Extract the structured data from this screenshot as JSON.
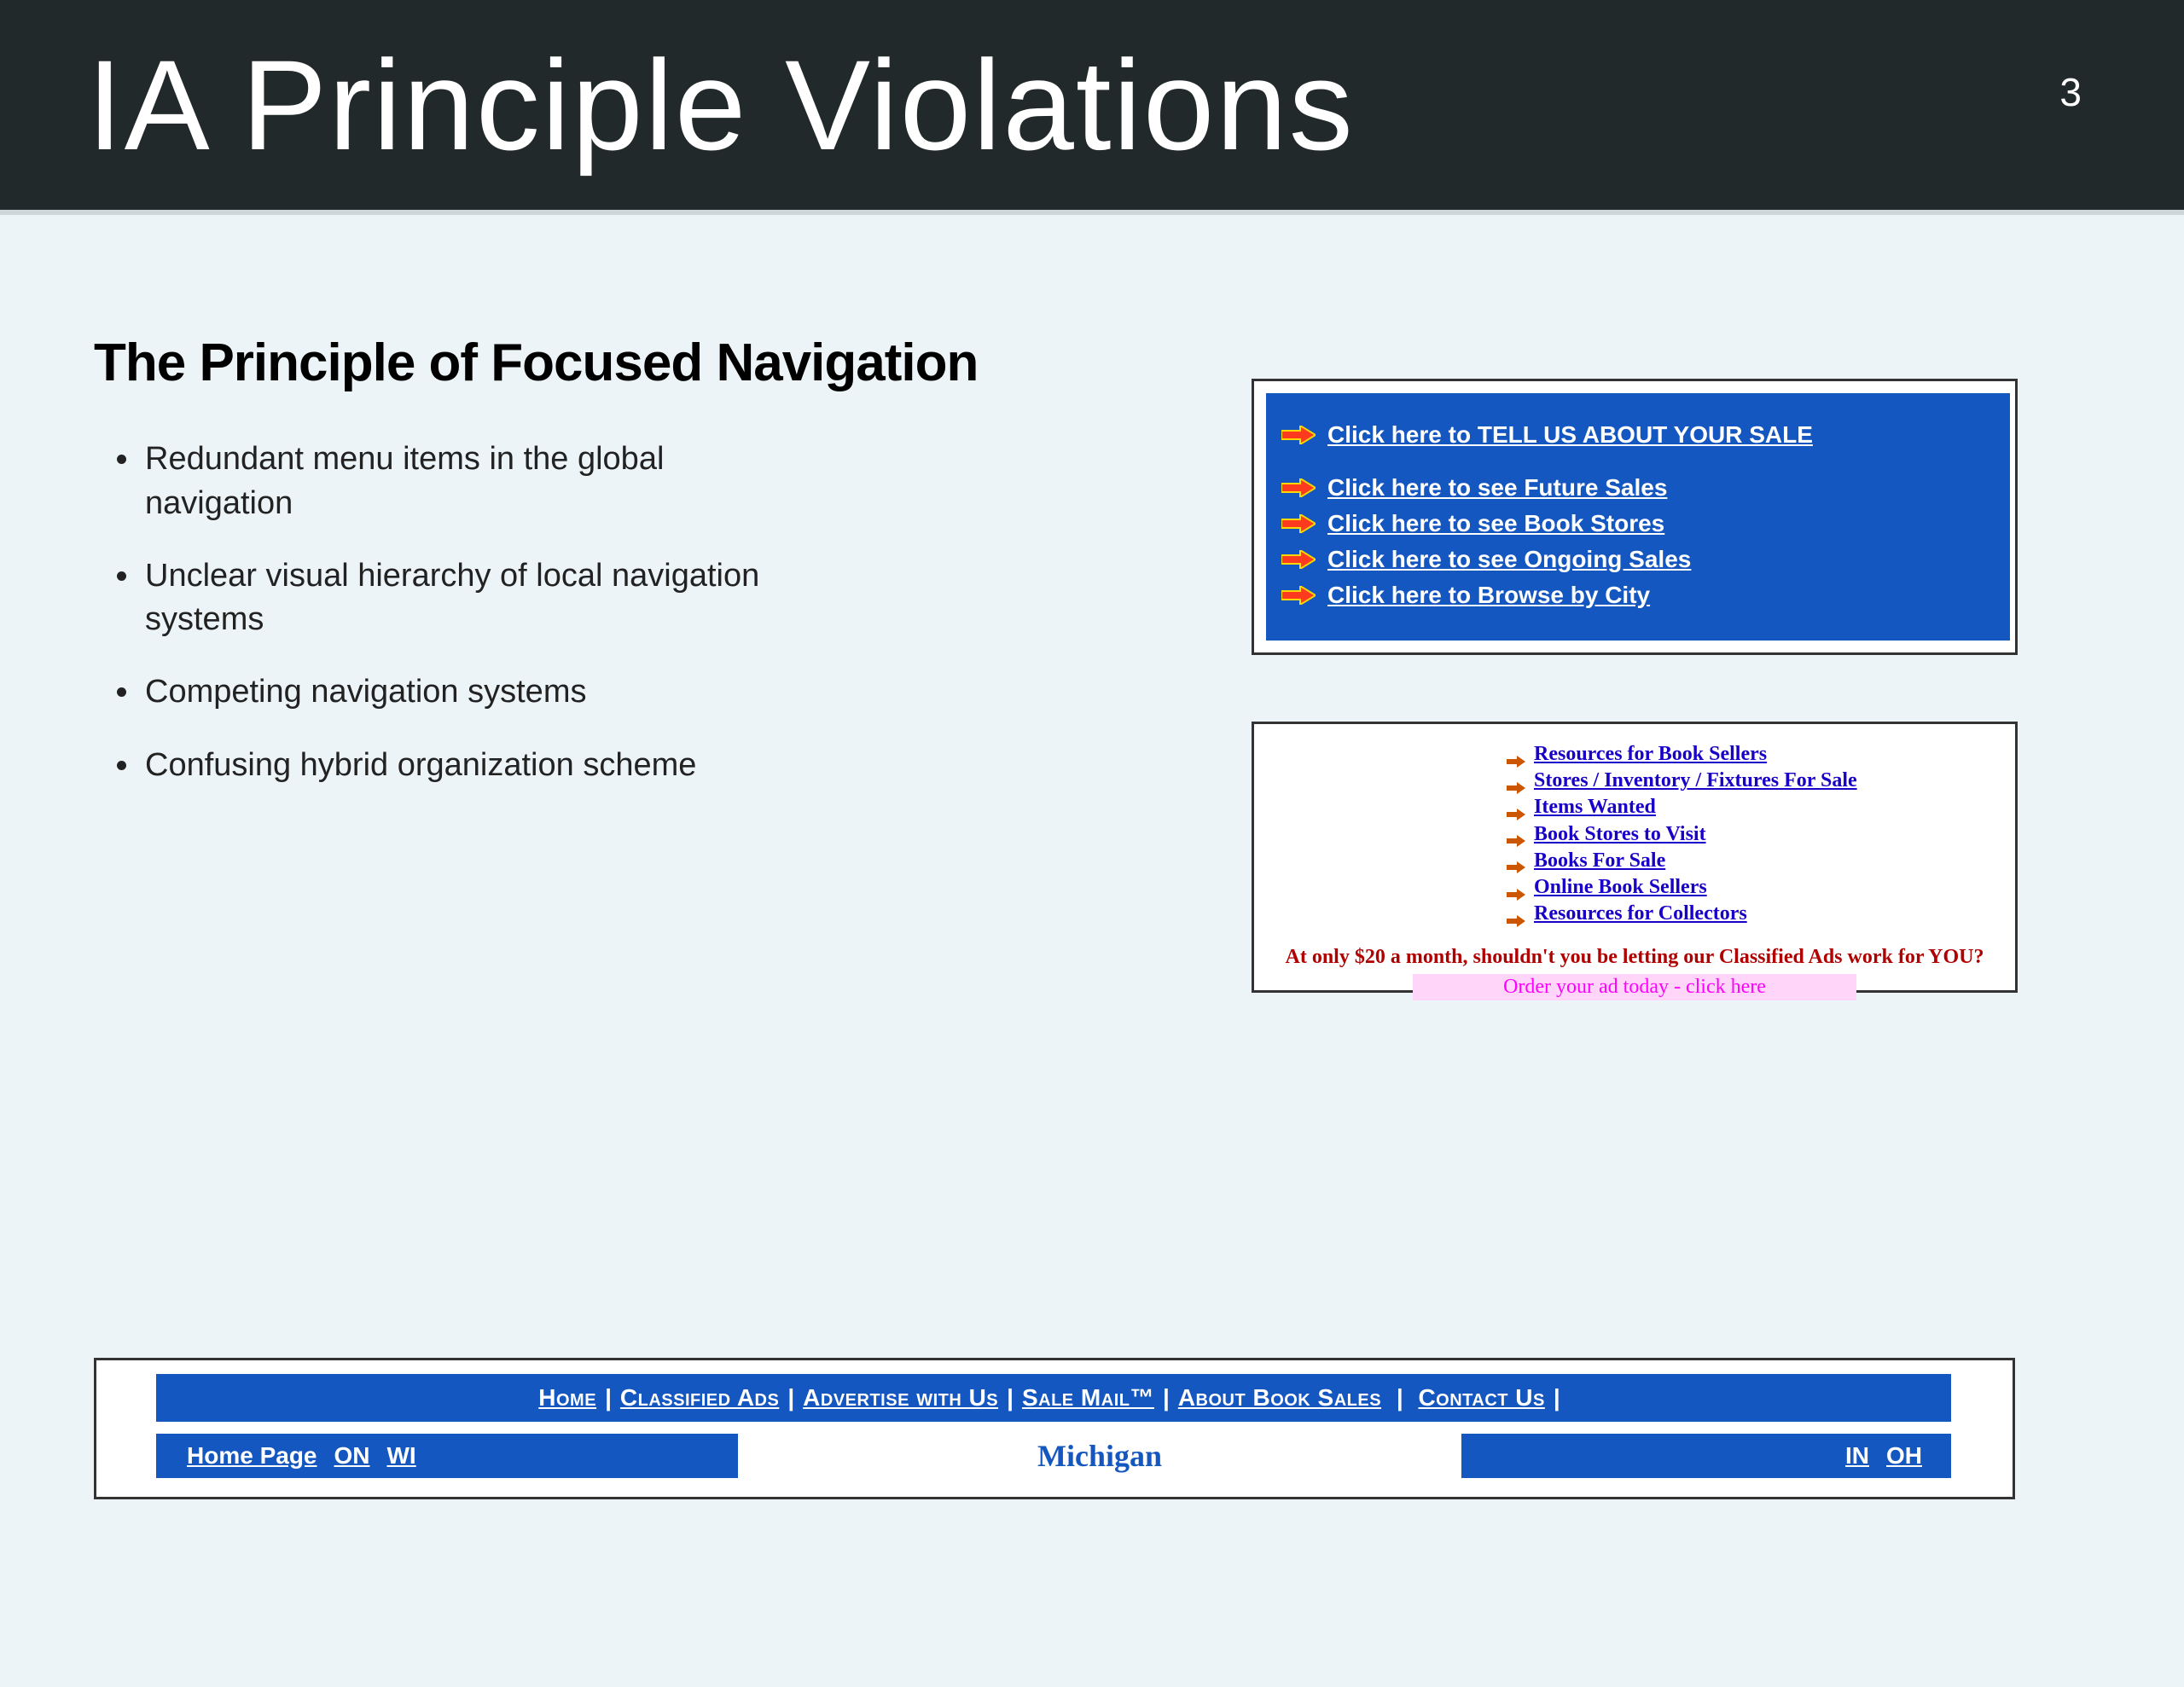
{
  "header": {
    "title": "IA Principle Violations",
    "page_number": "3"
  },
  "section": {
    "title": "The Principle of Focused Navigation",
    "bullets": [
      "Redundant menu items in the global navigation",
      "Unclear visual hierarchy of local navigation systems",
      "Competing navigation systems",
      "Confusing hybrid organization scheme"
    ]
  },
  "ex1": {
    "links": [
      "Click here to TELL US ABOUT YOUR SALE",
      "Click here to see Future Sales",
      "Click here to see Book Stores",
      "Click here to see Ongoing Sales",
      "Click here to Browse by City"
    ]
  },
  "ex2": {
    "links": [
      "Resources for Book Sellers",
      "Stores / Inventory / Fixtures For Sale",
      "Items Wanted",
      "Book Stores to Visit",
      "Books For Sale",
      "Online Book Sellers",
      "Resources for Collectors"
    ],
    "tagline": "At only $20 a month, shouldn't you be letting our Classified Ads work for YOU?",
    "order": "Order your ad today - click here"
  },
  "ex3": {
    "top": {
      "items": [
        "Home",
        "Classified Ads",
        "Advertise with Us",
        "Sale Mail™",
        "About Book Sales",
        "Contact Us"
      ]
    },
    "bot": {
      "home": "Home Page",
      "left_states": [
        "ON",
        "WI"
      ],
      "center": "Michigan",
      "right_states": [
        "IN",
        "OH"
      ]
    }
  }
}
